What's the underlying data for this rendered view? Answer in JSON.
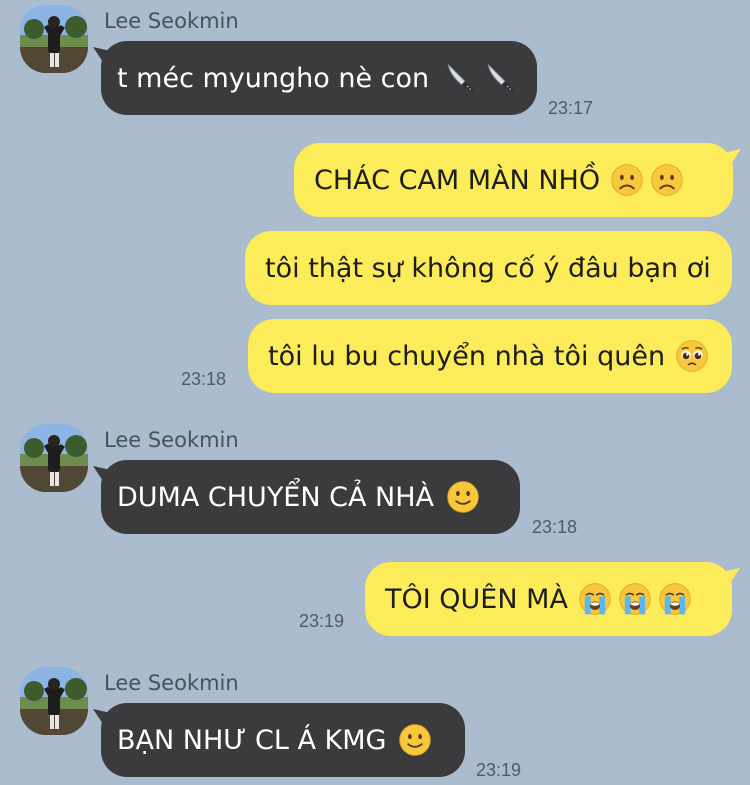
{
  "chat": {
    "messages": [
      {
        "id": "m1",
        "direction": "incoming",
        "sender": "Lee Seokmin",
        "text": "t méc myungho nè con",
        "emoji": [
          "knife-icon",
          "knife-icon"
        ],
        "time": "23:17"
      },
      {
        "id": "m2",
        "direction": "outgoing",
        "text": "CHÁC CAM MÀN NHỒ",
        "emoji": [
          "frowning-face-icon",
          "frowning-face-icon"
        ],
        "time": ""
      },
      {
        "id": "m3",
        "direction": "outgoing",
        "text": "tôi thật sự không cố ý đâu bạn ơi",
        "emoji": [],
        "time": ""
      },
      {
        "id": "m4",
        "direction": "outgoing",
        "text": "tôi lu bu chuyển nhà tôi quên",
        "emoji": [
          "pleading-face-icon"
        ],
        "time": "23:18"
      },
      {
        "id": "m5",
        "direction": "incoming",
        "sender": "Lee Seokmin",
        "text": "DUMA CHUYỂN CẢ NHÀ",
        "emoji": [
          "slightly-smiling-face-icon"
        ],
        "time": "23:18"
      },
      {
        "id": "m6",
        "direction": "outgoing",
        "text": "TÔI QUÊN MÀ",
        "emoji": [
          "crying-face-icon",
          "crying-face-icon",
          "crying-face-icon"
        ],
        "time": "23:19"
      },
      {
        "id": "m7",
        "direction": "incoming",
        "sender": "Lee Seokmin",
        "text": "BẠN NHƯ CL Á KMG",
        "emoji": [
          "slightly-smiling-face-icon"
        ],
        "time": "23:19"
      }
    ]
  },
  "colors": {
    "background": "#aabccd",
    "incoming_bubble": "#3b3b3d",
    "outgoing_bubble": "#fcec5a"
  }
}
